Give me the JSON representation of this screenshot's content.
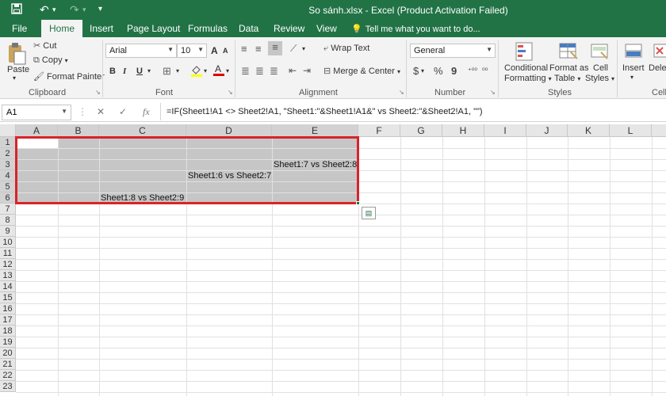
{
  "titlebar": {
    "title": "So sánh.xlsx - Excel (Product Activation Failed)"
  },
  "tabs": [
    {
      "label": "File"
    },
    {
      "label": "Home"
    },
    {
      "label": "Insert"
    },
    {
      "label": "Page Layout"
    },
    {
      "label": "Formulas"
    },
    {
      "label": "Data"
    },
    {
      "label": "Review"
    },
    {
      "label": "View"
    },
    {
      "label": "Tell me what you want to do..."
    }
  ],
  "clipboard": {
    "paste": "Paste",
    "cut": "Cut",
    "copy": "Copy",
    "format_painter": "Format Painter",
    "group": "Clipboard"
  },
  "font": {
    "family": "Arial",
    "size": "10",
    "bold": "B",
    "italic": "I",
    "underline": "U",
    "grow": "A",
    "shrink": "A",
    "group": "Font"
  },
  "alignment": {
    "wrap": "Wrap Text",
    "merge": "Merge & Center",
    "group": "Alignment"
  },
  "number": {
    "format": "General",
    "currency": "$",
    "percent": "%",
    "comma": "9",
    "group": "Number"
  },
  "styles": {
    "conditional": "Conditional",
    "conditional2": "Formatting",
    "format_as": "Format as",
    "format_as2": "Table",
    "cell": "Cell",
    "cell2": "Styles",
    "group": "Styles"
  },
  "cells": {
    "insert": "Insert",
    "delete": "Delete",
    "group": "Cells"
  },
  "formula_bar": {
    "namebox": "A1",
    "cancel": "✕",
    "enter": "✓",
    "fx": "fx",
    "formula": "=IF(Sheet1!A1 <> Sheet2!A1, \"Sheet1:\"&Sheet1!A1&\" vs Sheet2:\"&Sheet2!A1, \"\")"
  },
  "grid": {
    "columns": [
      "A",
      "B",
      "C",
      "D",
      "E",
      "F",
      "G",
      "H",
      "I",
      "J",
      "K",
      "L"
    ],
    "rows": [
      "1",
      "2",
      "3",
      "4",
      "5",
      "6",
      "7",
      "8",
      "9",
      "10",
      "11",
      "12",
      "13",
      "14",
      "15",
      "16",
      "17",
      "18",
      "19",
      "20",
      "21",
      "22",
      "23"
    ],
    "cells": {
      "C6": "Sheet1:8 vs Sheet2:9",
      "D4": "Sheet1:6 vs Sheet2:7",
      "E3": "Sheet1:7 vs Sheet2:8"
    }
  },
  "colors": {
    "excel_green": "#217346",
    "selection_gray": "#c6c6c6",
    "highlight_red": "#d9232a"
  }
}
